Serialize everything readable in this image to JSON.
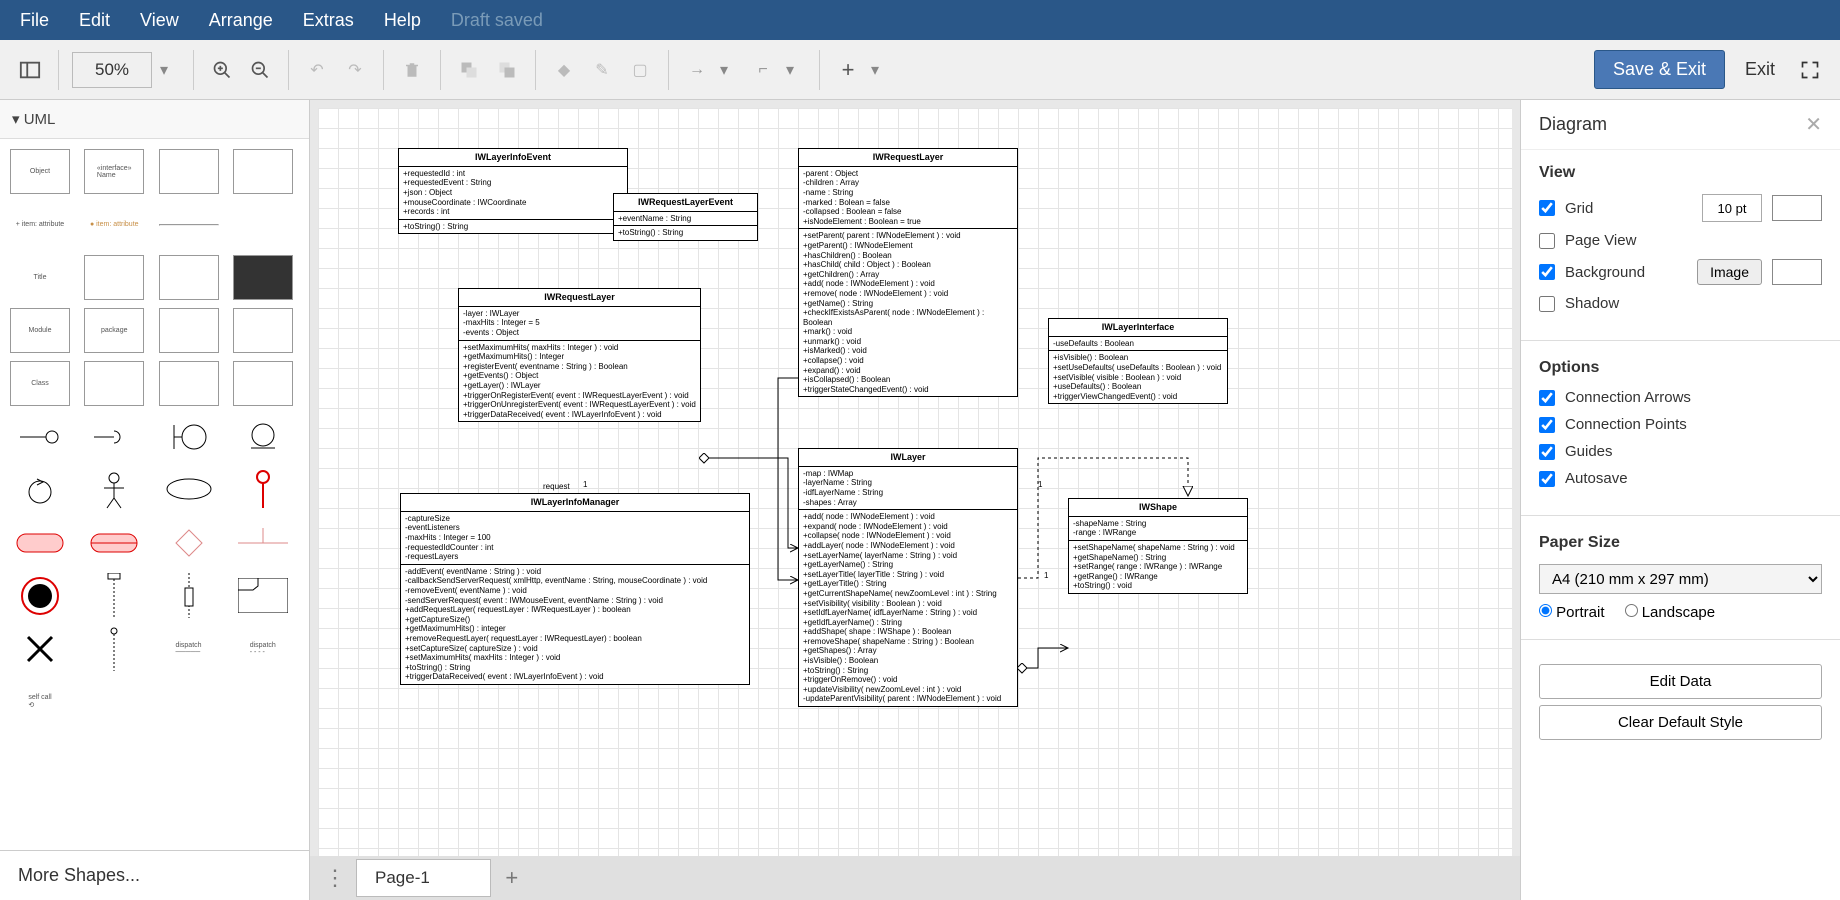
{
  "menu": {
    "file": "File",
    "edit": "Edit",
    "view": "View",
    "arrange": "Arrange",
    "extras": "Extras",
    "help": "Help",
    "saved": "Draft saved"
  },
  "toolbar": {
    "zoom": "50%",
    "save_exit": "Save & Exit",
    "exit": "Exit"
  },
  "shapes": {
    "category": "UML",
    "more": "More Shapes..."
  },
  "tabs": {
    "page1": "Page-1"
  },
  "right": {
    "title": "Diagram",
    "view": "View",
    "grid": "Grid",
    "grid_size": "10 pt",
    "page_view": "Page View",
    "background": "Background",
    "image": "Image",
    "shadow": "Shadow",
    "options": "Options",
    "conn_arrows": "Connection Arrows",
    "conn_points": "Connection Points",
    "guides": "Guides",
    "autosave": "Autosave",
    "paper_size": "Paper Size",
    "paper_value": "A4 (210 mm x 297 mm)",
    "portrait": "Portrait",
    "landscape": "Landscape",
    "edit_data": "Edit Data",
    "clear_style": "Clear Default Style"
  },
  "uml": {
    "IWLayerInfoEvent": {
      "attrs": "+requestedId : int\n+requestedEvent : String\n+json : Object\n+mouseCoordinate : IWCoordinate\n+records : int",
      "methods": "+toString() : String"
    },
    "IWRequestLayerEvent": {
      "attrs": "+eventName : String",
      "methods": "+toString() : String"
    },
    "IWRequestLayer_small": {
      "attrs": "-layer : IWLayer\n-maxHits : Integer = 5\n-events : Object",
      "methods": "+setMaximumHits( maxHits : Integer ) : void\n+getMaximumHits() : Integer\n+registerEvent( eventname : String ) : Boolean\n+getEvents() : Object\n+getLayer() : IWLayer\n+triggerOnRegisterEvent( event : IWRequestLayerEvent ) : void\n+triggerOnUnregisterEvent( event : IWRequestLayerEvent ) : void\n+triggerDataReceived( event : IWLayerInfoEvent ) : void"
    },
    "IWLayerInfoManager": {
      "attrs": "-captureSize\n-eventListeners\n-maxHits : Integer = 100\n-requestedIdCounter : int\n-requestLayers",
      "methods": "-addEvent( eventName : String ) : void\n-callbackSendServerRequest( xmlHttp, eventName : String, mouseCoordinate ) : void\n-removeEvent( eventName ) : void\n-sendServerRequest( event : IWMouseEvent, eventName : String ) : void\n+addRequestLayer( requestLayer : IWRequestLayer ) : boolean\n+getCaptureSize()\n+getMaximumHits() : integer\n+removeRequestLayer( requestLayer : IWRequestLayer) : boolean\n+setCaptureSize( captureSize ) : void\n+setMaximumHits( maxHits : Integer ) : void\n+toString() : String\n+triggerDataReceived( event : IWLayerInfoEvent ) : void"
    },
    "IWRequestLayer_big": {
      "attrs": "-parent : Object\n-children : Array\n-name : String\n-marked : Bolean = false\n-collapsed : Boolean = false\n+isNodeElement : Boolean = true",
      "methods": "+setParent( parent : IWNodeElement ) : void\n+getParent() : IWNodeElement\n+hasChildren() : Boolean\n+hasChild( child : Object ) : Boolean\n+getChildren() : Array\n+add( node : IWNodeElement ) : void\n+remove( node : IWNodeElement ) : void\n+getName() : String\n+checkIfExistsAsParent( node : IWNodeElement ) : Boolean\n+mark() : void\n+unmark() : void\n+isMarked() : void\n+collapse() : void\n+expand() : void\n+isCollapsed() : Boolean\n+triggerStateChangedEvent() : void"
    },
    "IWLayerInterface": {
      "attrs": "-useDefaults : Boolean",
      "methods": "+isVisible() : Boolean\n+setUseDefaults( useDefaults : Boolean ) : void\n+setVisible( visible : Boolean ) : void\n+useDefaults() : Boolean\n+triggerViewChangedEvent() : void"
    },
    "IWLayer": {
      "attrs": "-map : IWMap\n-layerName : String\n-idfLayerName : String\n-shapes : Array",
      "methods": "+add( node : IWNodeElement ) : void\n+expand( node : IWNodeElement ) : void\n+collapse( node : IWNodeElement ) : void\n+addLayer( node : IWNodeElement ) : void\n+setLayerName( layerName : String ) : void\n+getLayerName() : String\n+setLayerTitle( layerTitle : String ) : void\n+getLayerTitle() : String\n+getCurrentShapeName( newZoomLevel : int ) : String\n+setVisibility( visibility : Boolean ) : void\n+setIdfLayerName( idfLayerName : String ) : void\n+getIdfLayerName() : String\n+addShape( shape : IWShape ) : Boolean\n+removeShape( shapeName : String ) : Boolean\n+getShapes() : Array\n+isVisible() : Boolean\n+toString() : String\n+triggerOnRemove() : void\n+updateVisibility( newZoomLevel : int ) : void\n-updateParentVisibility( parent : IWNodeElement ) : void"
    },
    "IWShape": {
      "attrs": "-shapeName : String\n-range : IWRange",
      "methods": "+setShapeName( shapeName : String ) : void\n+getShapeName() : String\n+setRange( range : IWRange ) : IWRange\n+getRange() : IWRange\n+toString() : void"
    }
  },
  "labels": {
    "request": "request",
    "one": "1"
  }
}
